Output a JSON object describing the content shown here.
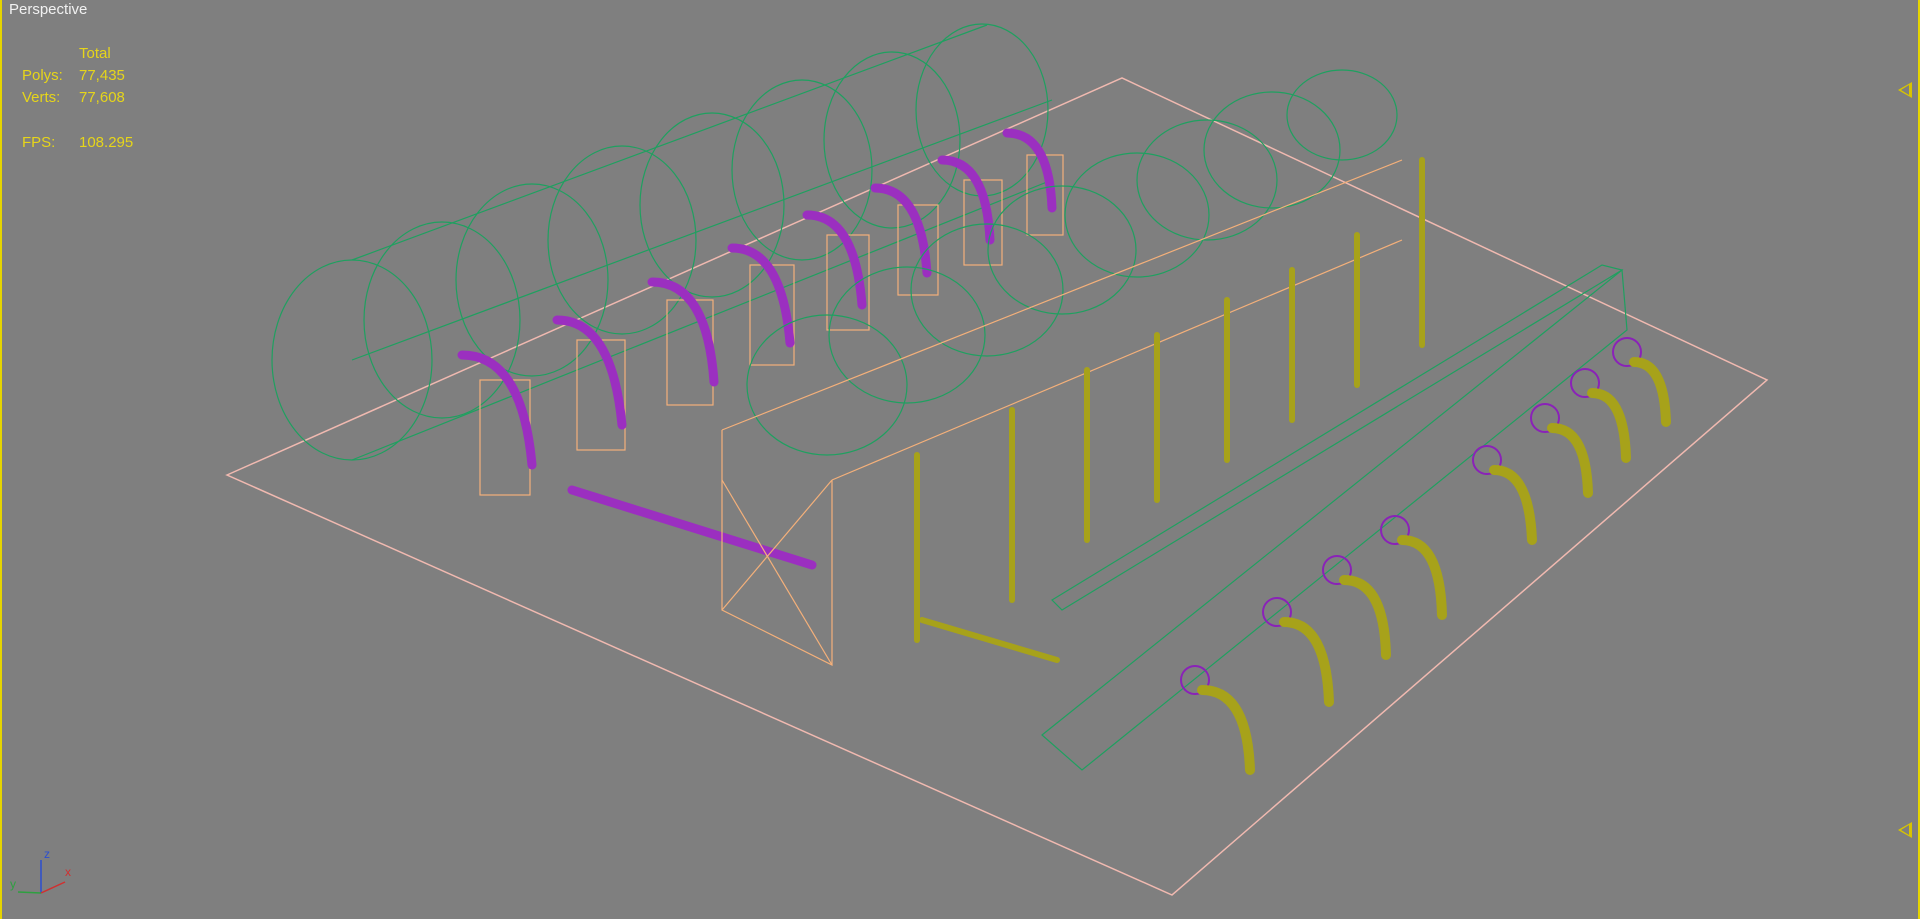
{
  "viewport": {
    "label": "Perspective",
    "colors": {
      "background": "#7f7f7f",
      "border": "#e5d400",
      "stats_text": "#e6d51a",
      "tank_wire": "#1fa060",
      "support_wire": "#f4b07a",
      "pipe_wire": "#9b2fc0",
      "structure_wire": "#a7a21a",
      "grid_line": "#f0b9b0"
    }
  },
  "stats": {
    "header": "Total",
    "rows": [
      {
        "key": "Polys:",
        "value": "77,435"
      },
      {
        "key": "Verts:",
        "value": "77,608"
      },
      {
        "key": "FPS:",
        "value": "108.295"
      }
    ]
  },
  "gizmo": {
    "z_label": "z",
    "x_label": "x",
    "y_label": "y"
  }
}
